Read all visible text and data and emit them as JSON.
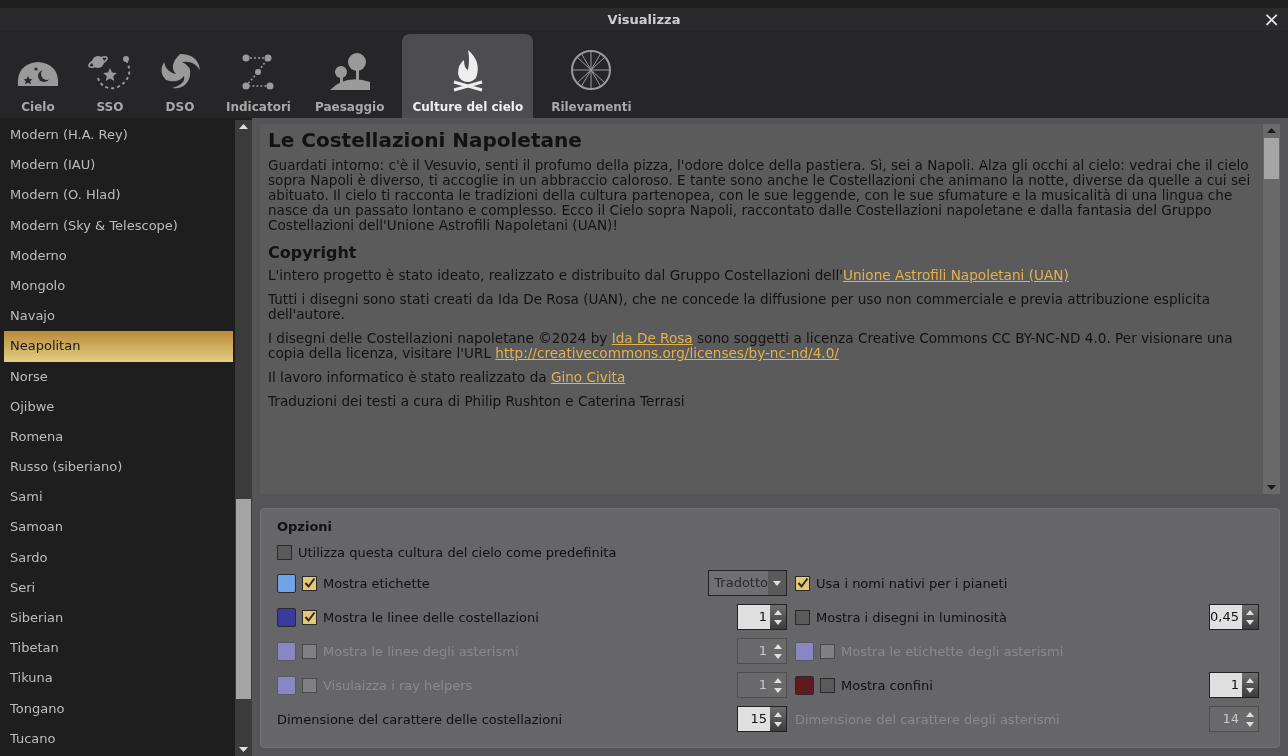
{
  "window": {
    "title": "Visualizza",
    "close": "×"
  },
  "tabs": [
    {
      "label": "Cielo",
      "selected": false
    },
    {
      "label": "SSO",
      "selected": false
    },
    {
      "label": "DSO",
      "selected": false
    },
    {
      "label": "Indicatori",
      "selected": false
    },
    {
      "label": "Paesaggio",
      "selected": false
    },
    {
      "label": "Culture del cielo",
      "selected": true
    },
    {
      "label": "Rilevamenti",
      "selected": false
    }
  ],
  "sidebar": {
    "items": [
      {
        "label": "Modern (H.A. Rey)",
        "selected": false
      },
      {
        "label": "Modern (IAU)",
        "selected": false
      },
      {
        "label": "Modern (O. Hlad)",
        "selected": false
      },
      {
        "label": "Modern (Sky & Telescope)",
        "selected": false
      },
      {
        "label": "Moderno",
        "selected": false
      },
      {
        "label": "Mongolo",
        "selected": false
      },
      {
        "label": "Navajo",
        "selected": false
      },
      {
        "label": "Neapolitan",
        "selected": true
      },
      {
        "label": "Norse",
        "selected": false
      },
      {
        "label": "Ojibwe",
        "selected": false
      },
      {
        "label": "Romena",
        "selected": false
      },
      {
        "label": "Russo (siberiano)",
        "selected": false
      },
      {
        "label": "Sami",
        "selected": false
      },
      {
        "label": "Samoan",
        "selected": false
      },
      {
        "label": "Sardo",
        "selected": false
      },
      {
        "label": "Seri",
        "selected": false
      },
      {
        "label": "Siberian",
        "selected": false
      },
      {
        "label": "Tibetan",
        "selected": false
      },
      {
        "label": "Tikuna",
        "selected": false
      },
      {
        "label": "Tongano",
        "selected": false
      },
      {
        "label": "Tucano",
        "selected": false
      }
    ]
  },
  "description": {
    "blocks": [
      {
        "kind": "heading1",
        "text": "Le Costellazioni Napoletane"
      },
      {
        "kind": "paragraph",
        "parts": [
          {
            "text": "Guardati intorno: c'è il Vesuvio, senti il profumo della pizza, l'odore dolce della pastiera. Sì, sei a Napoli. Alza gli occhi al cielo: vedrai che il cielo sopra Napoli è diverso, ti accoglie in un abbraccio caloroso. E tante sono anche le Costellazioni che animano la notte, diverse da quelle a cui sei abituato. Il cielo ti racconta le tradizioni della cultura partenopea, con le sue leggende, con le sue sfumature e la musicalità di una lingua che nasce da un passato lontano e complesso. Ecco il Cielo sopra Napoli, raccontato dalle Costellazioni napoletane e dalla fantasia del Gruppo Costellazioni dell'Unione Astrofili Napoletani (UAN)!",
            "link": false
          }
        ]
      },
      {
        "kind": "heading2",
        "text": "Copyright"
      },
      {
        "kind": "paragraph",
        "parts": [
          {
            "text": "L'intero progetto è stato ideato, realizzato e distribuito dal Gruppo Costellazioni dell'",
            "link": false
          },
          {
            "text": "Unione Astrofili Napoletani (UAN)",
            "link": true
          }
        ]
      },
      {
        "kind": "paragraph",
        "parts": [
          {
            "text": "Tutti i disegni sono stati creati da Ida De Rosa (UAN), che ne concede la diffusione per uso non commerciale e previa attribuzione esplicita dell'autore.",
            "link": false
          }
        ]
      },
      {
        "kind": "paragraph",
        "parts": [
          {
            "text": "I disegni delle Costellazioni napoletane ©2024 by ",
            "link": false
          },
          {
            "text": "Ida De Rosa",
            "link": true
          },
          {
            "text": " sono soggetti a licenza Creative Commons CC BY-NC-ND 4.0. Per visionare una copia della licenza, visitare l'URL ",
            "link": false
          },
          {
            "text": "http://creativecommons.org/licenses/by-nc-nd/4.0/",
            "link": true
          }
        ]
      },
      {
        "kind": "paragraph",
        "parts": [
          {
            "text": "Il lavoro informatico è stato realizzato da ",
            "link": false
          },
          {
            "text": "Gino Civita",
            "link": true
          }
        ]
      },
      {
        "kind": "paragraph",
        "parts": [
          {
            "text": "Traduzioni dei testi a cura di Philip Rushton e Caterina Terrasi",
            "link": false
          }
        ]
      }
    ]
  },
  "options": {
    "title": "Opzioni",
    "rows": [
      [
        {
          "kind": "check",
          "label": "Utilizza questa cultura del cielo come predefinita",
          "checked": false,
          "disabled": false
        }
      ],
      [
        {
          "kind": "check",
          "label": "Mostra etichette",
          "checked": true,
          "disabled": false,
          "color": "#6fa3e6"
        },
        {
          "kind": "dropdown",
          "value": "Tradotto",
          "disabled": false
        },
        {
          "kind": "check",
          "label": "Usa i nomi nativi per i pianeti",
          "checked": true,
          "disabled": false
        },
        {
          "kind": "none"
        }
      ],
      [
        {
          "kind": "check",
          "label": "Mostra le linee delle costellazioni",
          "checked": true,
          "disabled": false,
          "color": "#3a3a9e"
        },
        {
          "kind": "spin",
          "value": "1",
          "disabled": false
        },
        {
          "kind": "check",
          "label": "Mostra i disegni in luminosità",
          "checked": false,
          "disabled": false
        },
        {
          "kind": "spin",
          "value": "0,45",
          "disabled": false
        }
      ],
      [
        {
          "kind": "check",
          "label": "Mostra le linee degli asterismi",
          "checked": false,
          "disabled": true,
          "color": "#8a86c4"
        },
        {
          "kind": "spin",
          "value": "1",
          "disabled": true
        },
        {
          "kind": "check",
          "label": "Mostra le etichette degli asterismi",
          "checked": false,
          "disabled": true,
          "color": "#8a86c4"
        },
        {
          "kind": "none"
        }
      ],
      [
        {
          "kind": "check",
          "label": "Visulaizza i ray helpers",
          "checked": false,
          "disabled": true,
          "color": "#8a86c4"
        },
        {
          "kind": "spin",
          "value": "1",
          "disabled": true
        },
        {
          "kind": "check",
          "label": "Mostra confini",
          "checked": false,
          "disabled": false,
          "color": "#5e1a1e"
        },
        {
          "kind": "spin",
          "value": "1",
          "disabled": false
        }
      ],
      [
        {
          "kind": "text",
          "label": "Dimensione del carattere delle costellazioni",
          "disabled": false
        },
        {
          "kind": "spin",
          "value": "15",
          "disabled": false
        },
        {
          "kind": "text",
          "label": "Dimensione del carattere degli asterismi",
          "disabled": true
        },
        {
          "kind": "spin",
          "value": "14",
          "disabled": true
        }
      ]
    ]
  }
}
